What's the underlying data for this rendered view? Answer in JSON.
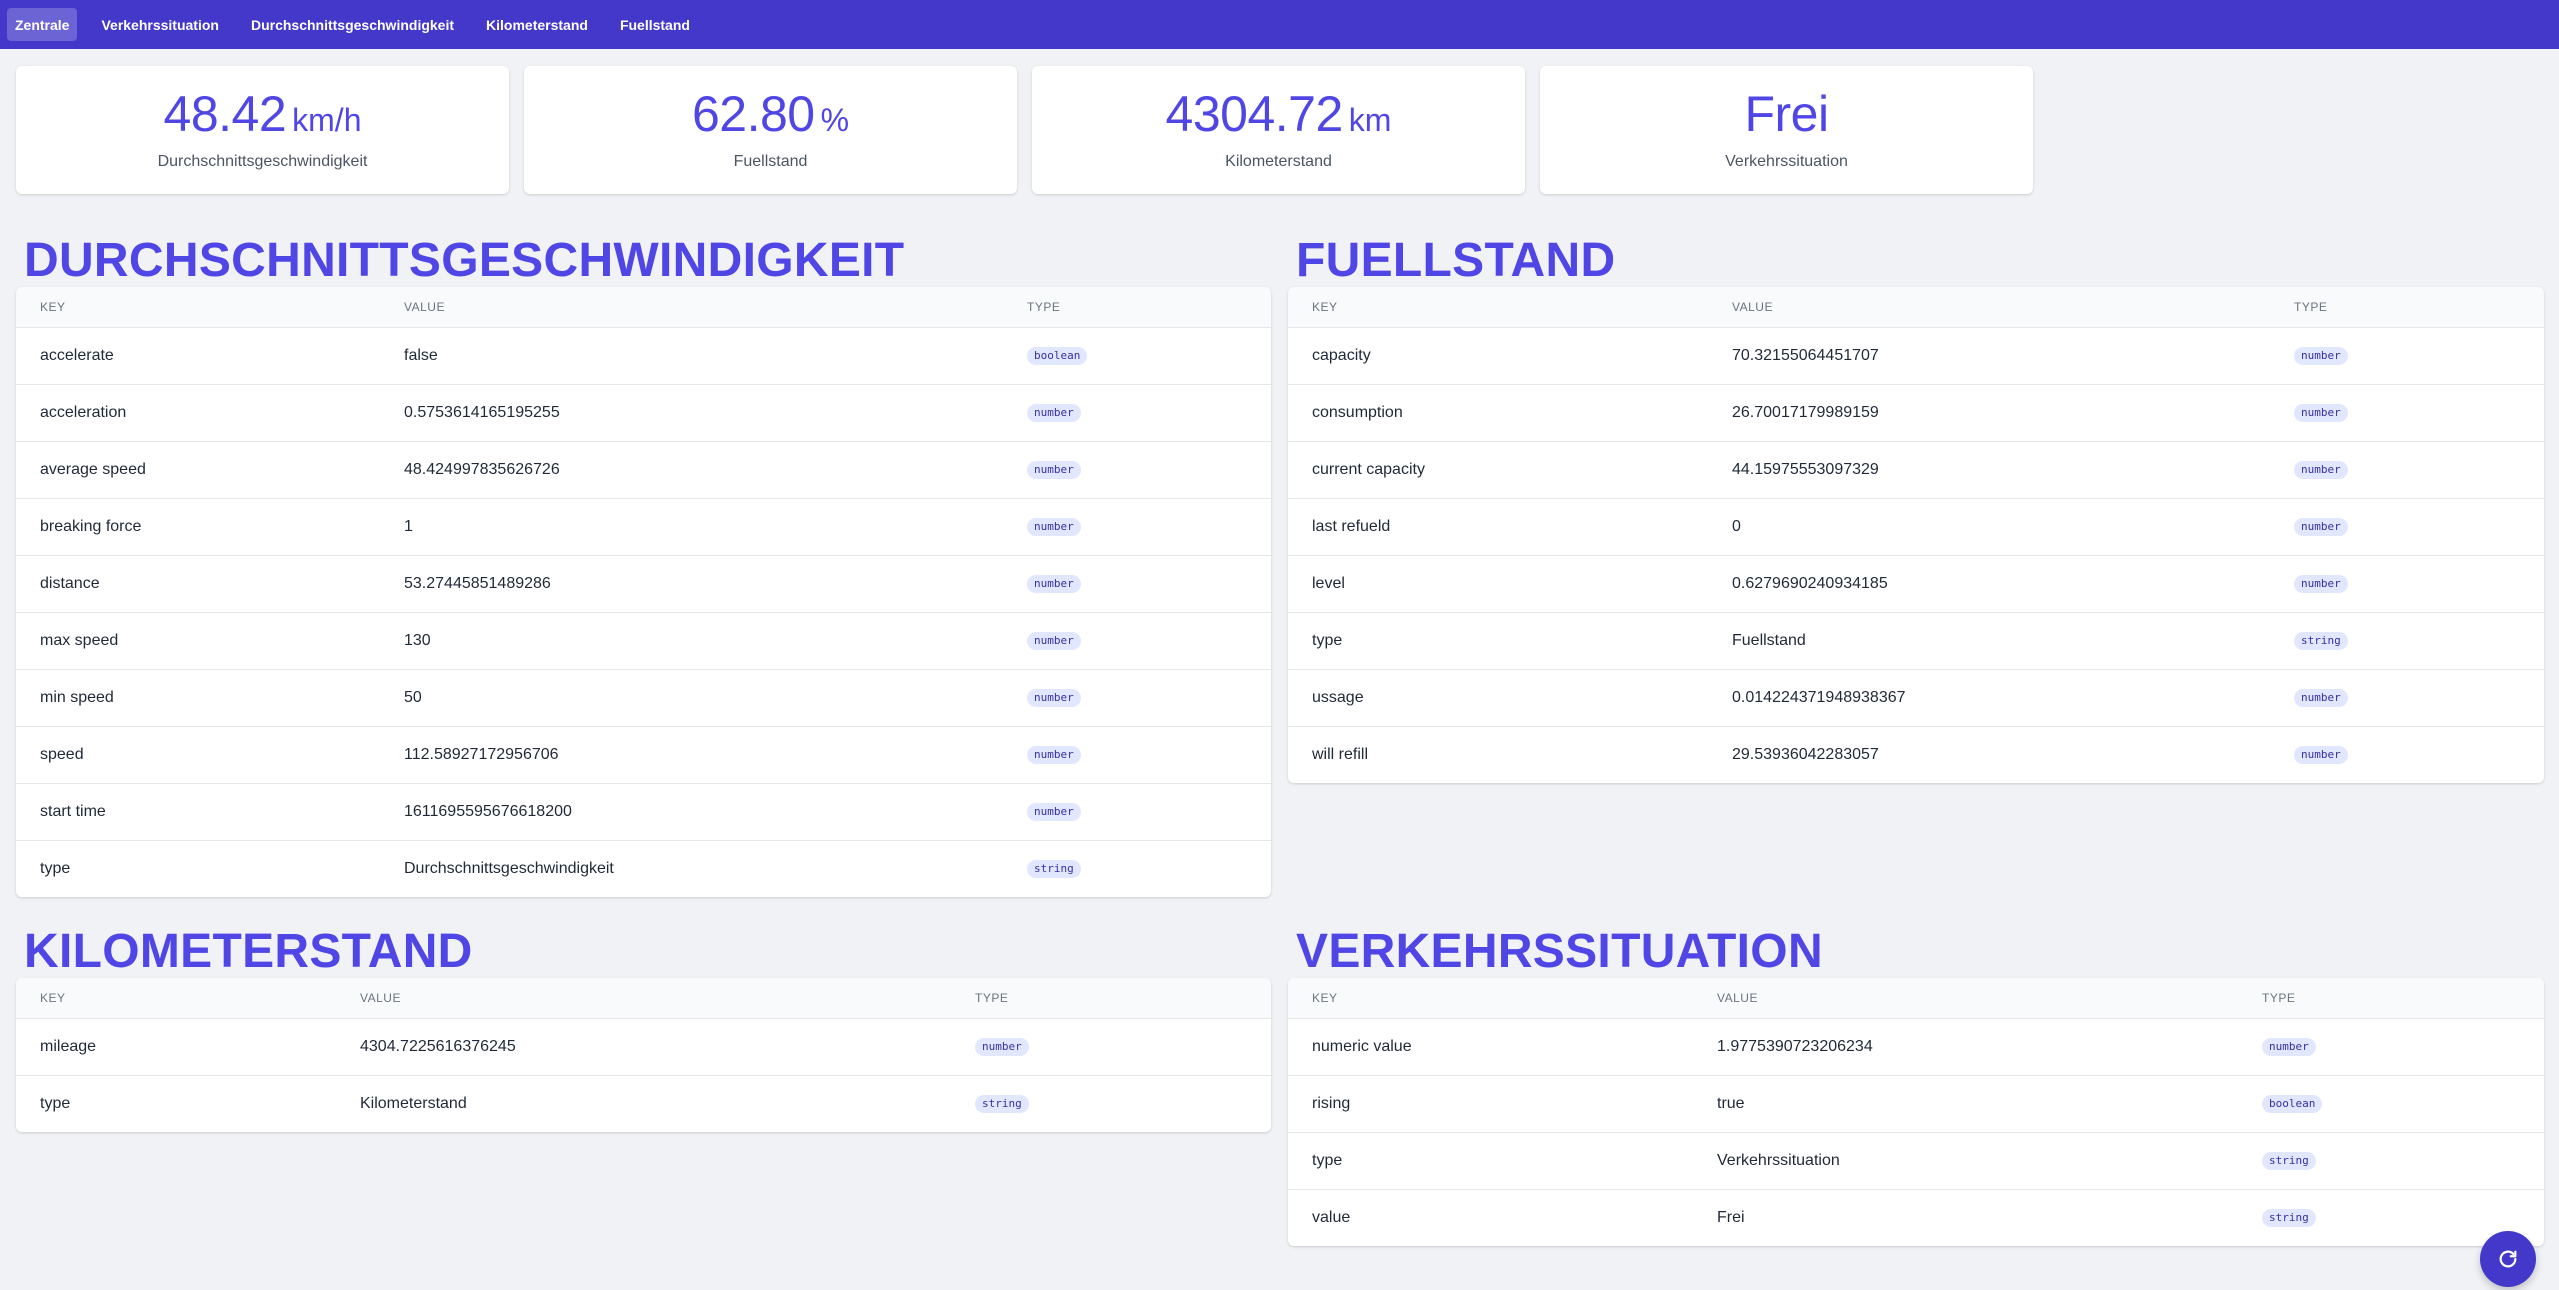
{
  "nav": {
    "items": [
      {
        "label": "Zentrale",
        "active": true
      },
      {
        "label": "Verkehrssituation",
        "active": false
      },
      {
        "label": "Durchschnittsgeschwindigkeit",
        "active": false
      },
      {
        "label": "Kilometerstand",
        "active": false
      },
      {
        "label": "Fuellstand",
        "active": false
      }
    ]
  },
  "stats": [
    {
      "value": "48.42",
      "unit": "km/h",
      "label": "Durchschnittsgeschwindigkeit"
    },
    {
      "value": "62.80",
      "unit": "%",
      "label": "Fuellstand"
    },
    {
      "value": "4304.72",
      "unit": "km",
      "label": "Kilometerstand"
    },
    {
      "value": "Frei",
      "unit": "",
      "label": "Verkehrssituation"
    }
  ],
  "headers": {
    "key": "KEY",
    "value": "VALUE",
    "type": "TYPE"
  },
  "sections": {
    "durchschnitt": {
      "title": "Durchschnittsgeschwindigkeit",
      "rows": [
        {
          "key": "accelerate",
          "value": "false",
          "type": "boolean"
        },
        {
          "key": "acceleration",
          "value": "0.5753614165195255",
          "type": "number"
        },
        {
          "key": "average speed",
          "value": "48.424997835626726",
          "type": "number"
        },
        {
          "key": "breaking force",
          "value": "1",
          "type": "number"
        },
        {
          "key": "distance",
          "value": "53.27445851489286",
          "type": "number"
        },
        {
          "key": "max speed",
          "value": "130",
          "type": "number"
        },
        {
          "key": "min speed",
          "value": "50",
          "type": "number"
        },
        {
          "key": "speed",
          "value": "112.58927172956706",
          "type": "number"
        },
        {
          "key": "start time",
          "value": "1611695595676618200",
          "type": "number"
        },
        {
          "key": "type",
          "value": "Durchschnittsgeschwindigkeit",
          "type": "string"
        }
      ]
    },
    "fuellstand": {
      "title": "Fuellstand",
      "rows": [
        {
          "key": "capacity",
          "value": "70.32155064451707",
          "type": "number"
        },
        {
          "key": "consumption",
          "value": "26.70017179989159",
          "type": "number"
        },
        {
          "key": "current capacity",
          "value": "44.15975553097329",
          "type": "number"
        },
        {
          "key": "last refueld",
          "value": "0",
          "type": "number"
        },
        {
          "key": "level",
          "value": "0.6279690240934185",
          "type": "number"
        },
        {
          "key": "type",
          "value": "Fuellstand",
          "type": "string"
        },
        {
          "key": "ussage",
          "value": "0.014224371948938367",
          "type": "number"
        },
        {
          "key": "will refill",
          "value": "29.53936042283057",
          "type": "number"
        }
      ]
    },
    "kilometerstand": {
      "title": "Kilometerstand",
      "rows": [
        {
          "key": "mileage",
          "value": "4304.7225616376245",
          "type": "number"
        },
        {
          "key": "type",
          "value": "Kilometerstand",
          "type": "string"
        }
      ]
    },
    "verkehr": {
      "title": "Verkehrssituation",
      "rows": [
        {
          "key": "numeric value",
          "value": "1.9775390723206234",
          "type": "number"
        },
        {
          "key": "rising",
          "value": "true",
          "type": "boolean"
        },
        {
          "key": "type",
          "value": "Verkehrssituation",
          "type": "string"
        },
        {
          "key": "value",
          "value": "Frei",
          "type": "string"
        }
      ]
    }
  },
  "fab": {
    "icon": "refresh-icon"
  },
  "colors": {
    "nav_bg": "#4338ca",
    "accent": "#4f46e5",
    "page_bg": "#f1f2f5",
    "badge_bg": "#e0e7ff"
  }
}
